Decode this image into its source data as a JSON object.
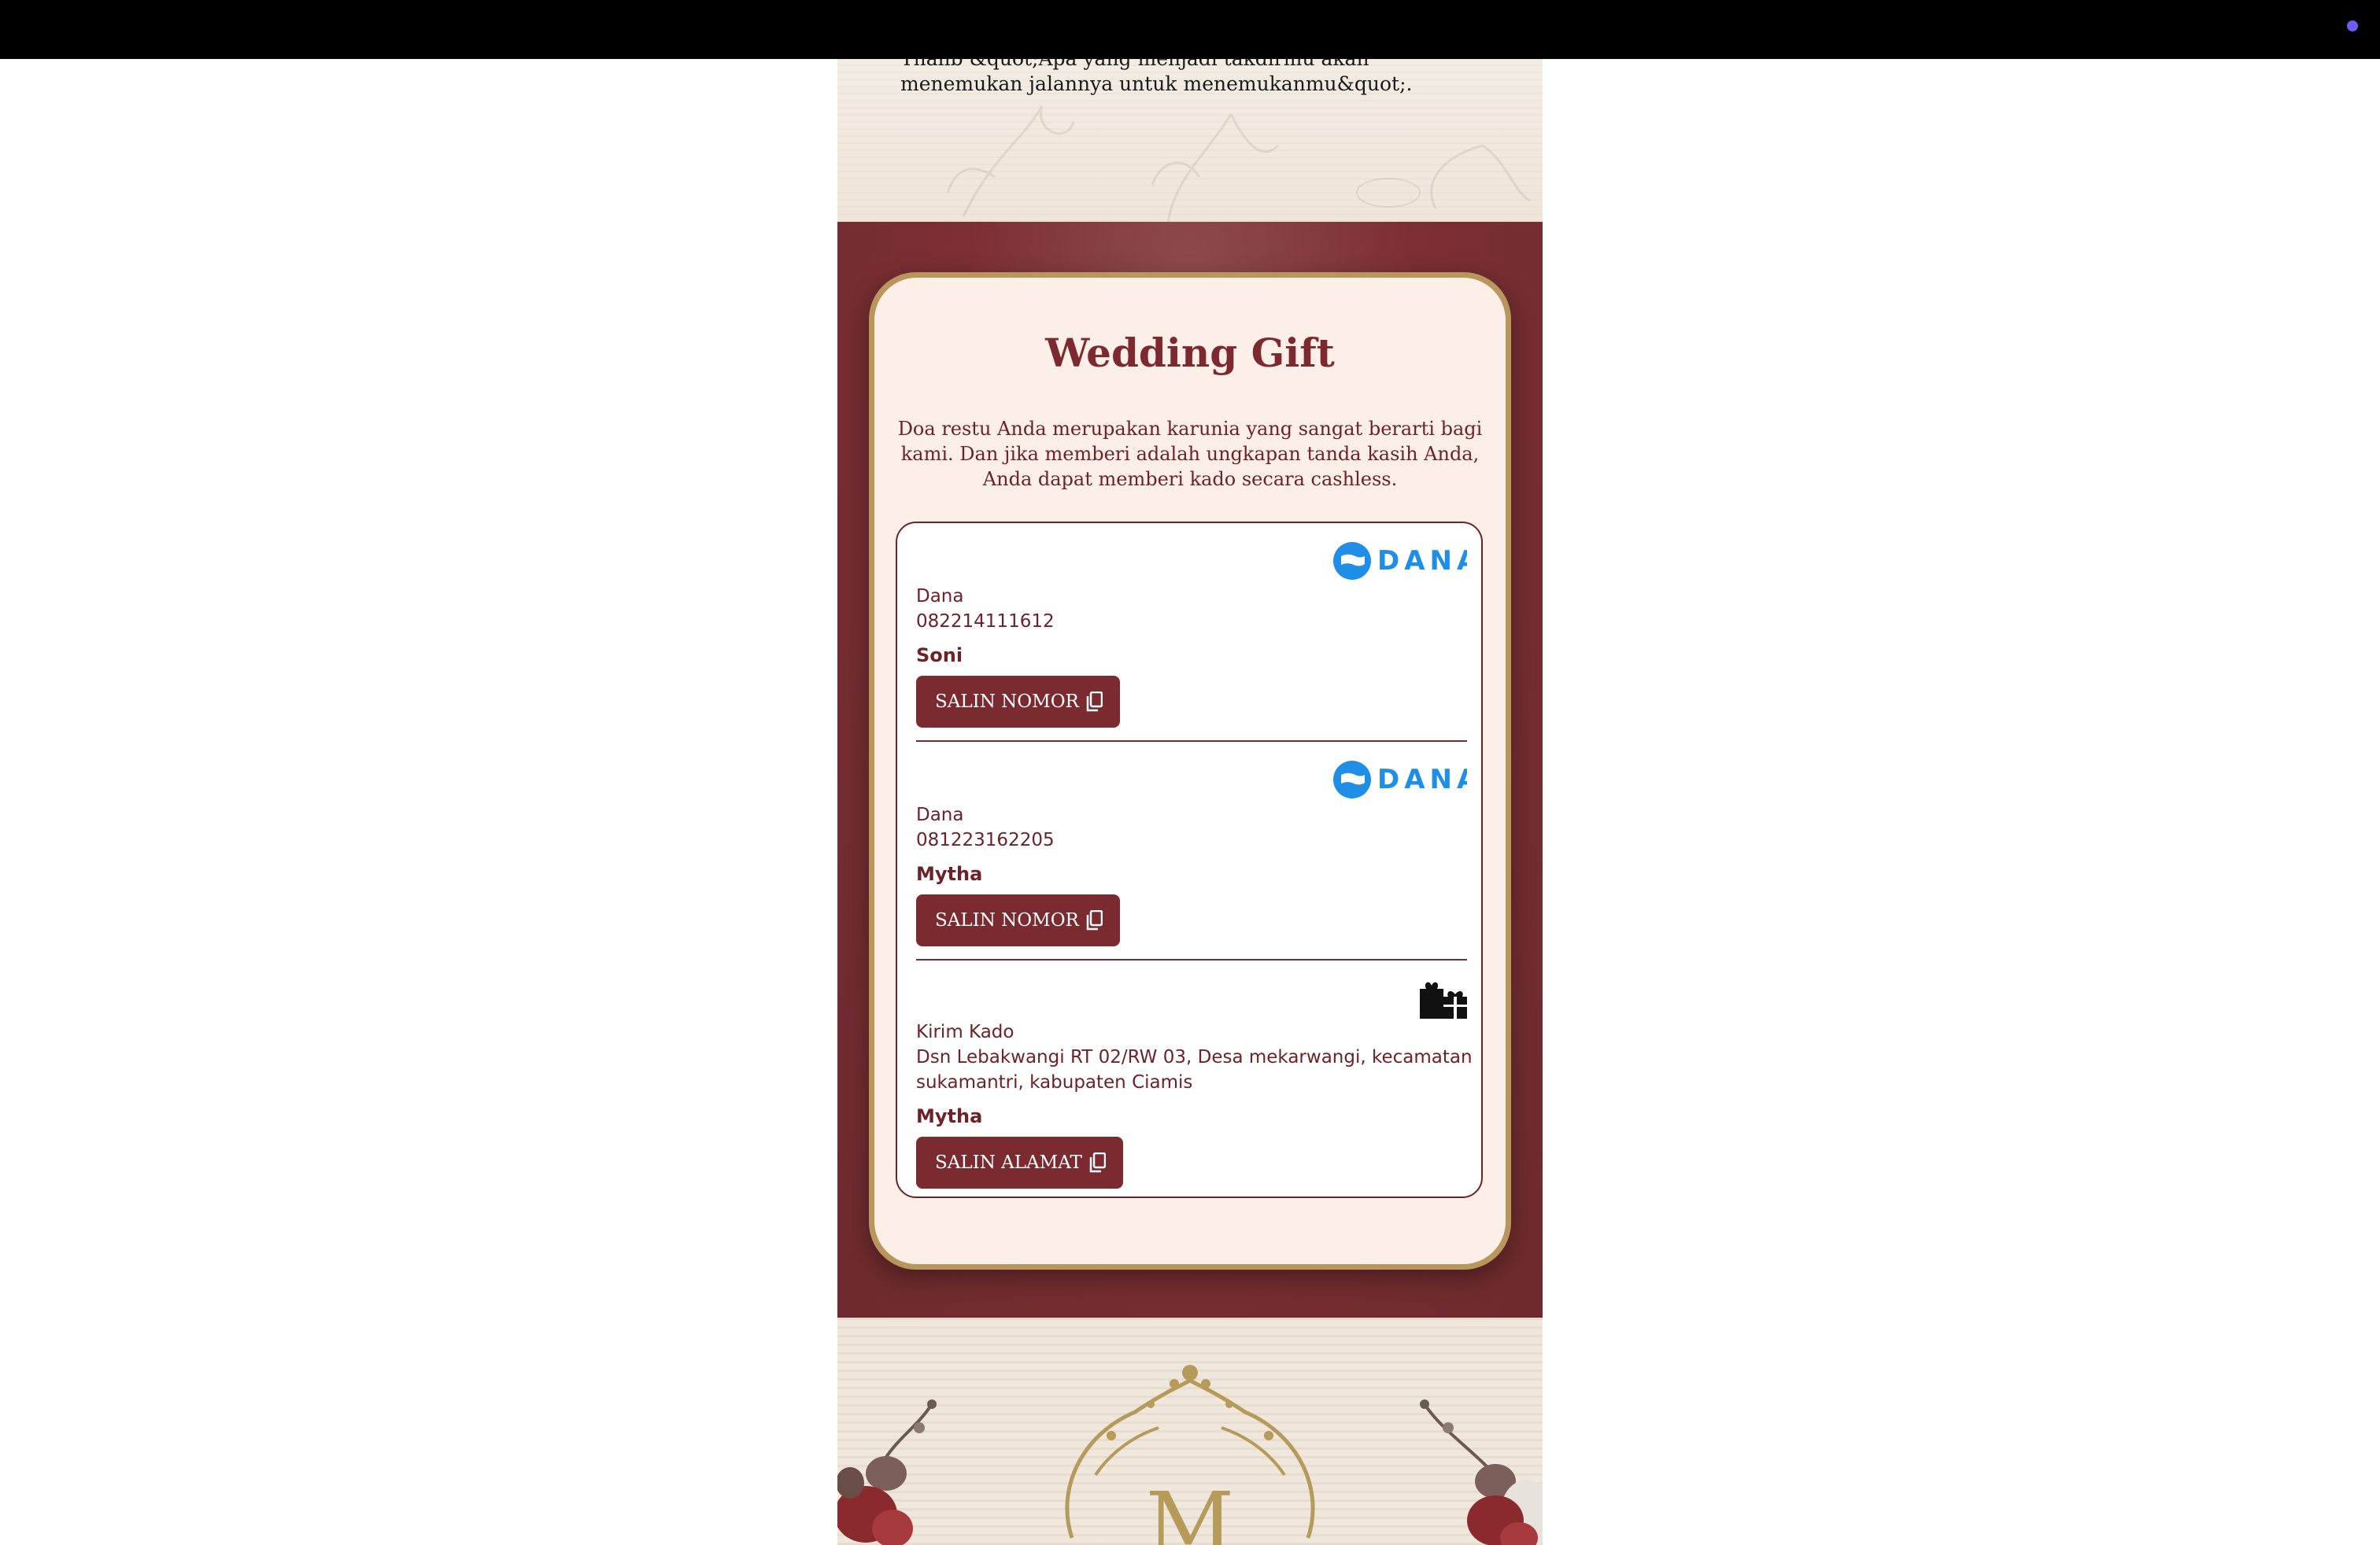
{
  "quote": {
    "text": "Thalib &quot;Apa yang menjadi takdirmu akan menemukan jalannya untuk menemukanmu&quot;."
  },
  "gift": {
    "title": "Wedding Gift",
    "description": "Doa restu Anda merupakan karunia yang sangat berarti bagi kami. Dan jika memberi adalah ungkapan tanda kasih Anda, Anda dapat memberi kado secara cashless."
  },
  "accounts": [
    {
      "logo": "DANA",
      "logo_icon": "dana-logo-icon",
      "type": "Dana",
      "number": "082214111612",
      "name": "Soni",
      "button_label": "SALIN NOMOR"
    },
    {
      "logo": "DANA",
      "logo_icon": "dana-logo-icon",
      "type": "Dana",
      "number": "081223162205",
      "name": "Mytha",
      "button_label": "SALIN NOMOR"
    },
    {
      "logo_icon": "gifts-icon",
      "type": "Kirim Kado",
      "address_line1": "Dsn Lebakwangi RT 02/RW 03, Desa mekarwangi, kecamatan",
      "address_line2": "sukamantri, kabupaten Ciamis",
      "name": "Mytha",
      "button_label": "SALIN ALAMAT"
    }
  ],
  "footer": {
    "monogram": "M"
  },
  "colors": {
    "maroon": "#7b2a30",
    "gold": "#b8965c",
    "cream": "#fbefe7",
    "dana_blue": "#1f8ee6"
  }
}
